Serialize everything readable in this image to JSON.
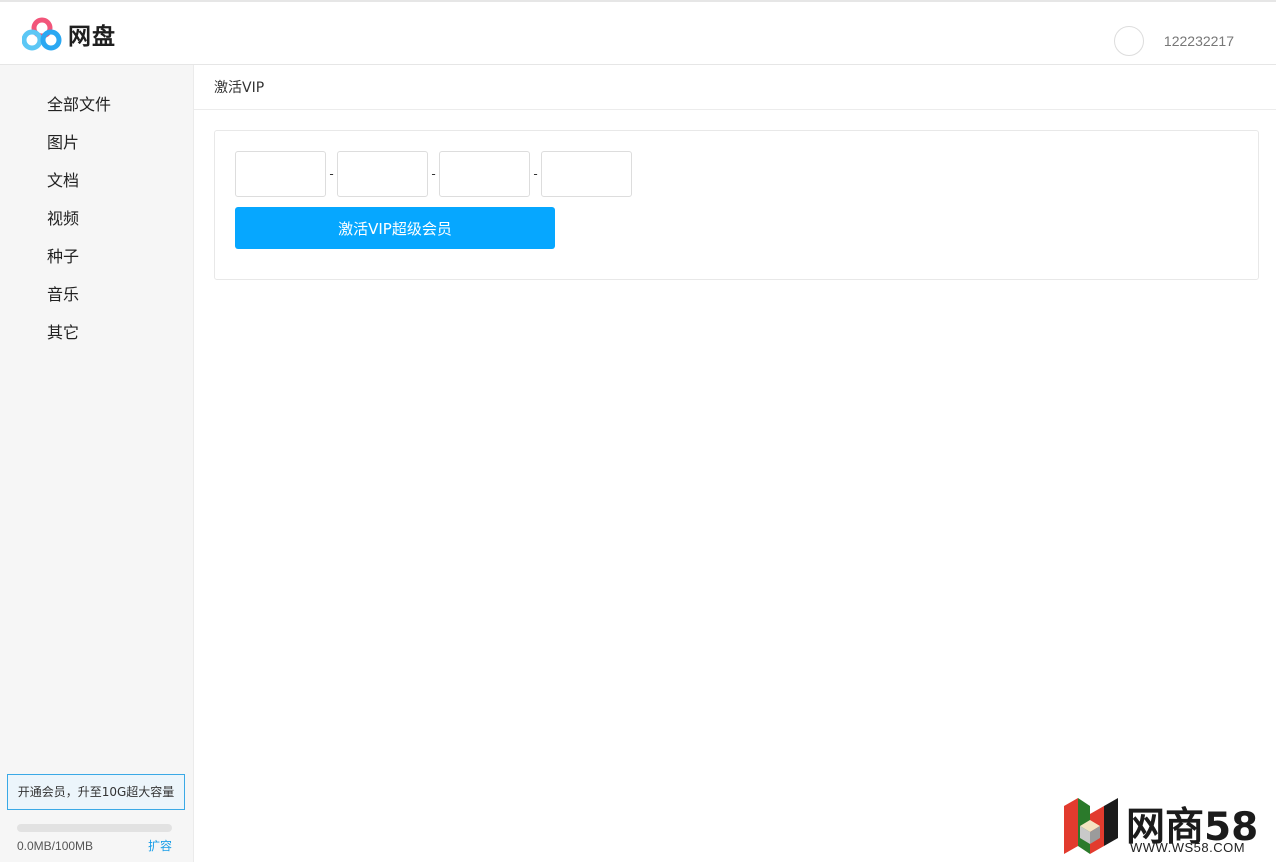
{
  "header": {
    "app_name": "网盘",
    "username": "122232217"
  },
  "sidebar": {
    "items": [
      {
        "label": "全部文件"
      },
      {
        "label": "图片"
      },
      {
        "label": "文档"
      },
      {
        "label": "视频"
      },
      {
        "label": "种子"
      },
      {
        "label": "音乐"
      },
      {
        "label": "其它"
      }
    ],
    "upgrade_label": "开通会员，升至10G超大容量",
    "quota_used_fraction": 0,
    "quota_text": "0.0MB/100MB",
    "expand_label": "扩容"
  },
  "main": {
    "breadcrumb": "激活VIP",
    "code_separator": "-",
    "code_inputs": [
      {
        "value": "",
        "placeholder": ""
      },
      {
        "value": "",
        "placeholder": ""
      },
      {
        "value": "",
        "placeholder": ""
      },
      {
        "value": "",
        "placeholder": ""
      }
    ],
    "activate_button_label": "激活VIP超级会员"
  },
  "watermark": {
    "title": "网商58",
    "subtitle": "WWW.WS58.COM"
  },
  "colors": {
    "accent": "#06a7ff",
    "link": "#1a9ee8",
    "sidebar_bg": "#f6f6f6",
    "logo_pink": "#f2557a",
    "logo_blue": "#2aa8f2",
    "logo_lightblue": "#5cc7f5"
  },
  "icons": {
    "logo": "cloud-rings-logo-icon",
    "avatar": "user-avatar-icon",
    "watermark_logo": "isometric-cubes-logo-icon"
  }
}
